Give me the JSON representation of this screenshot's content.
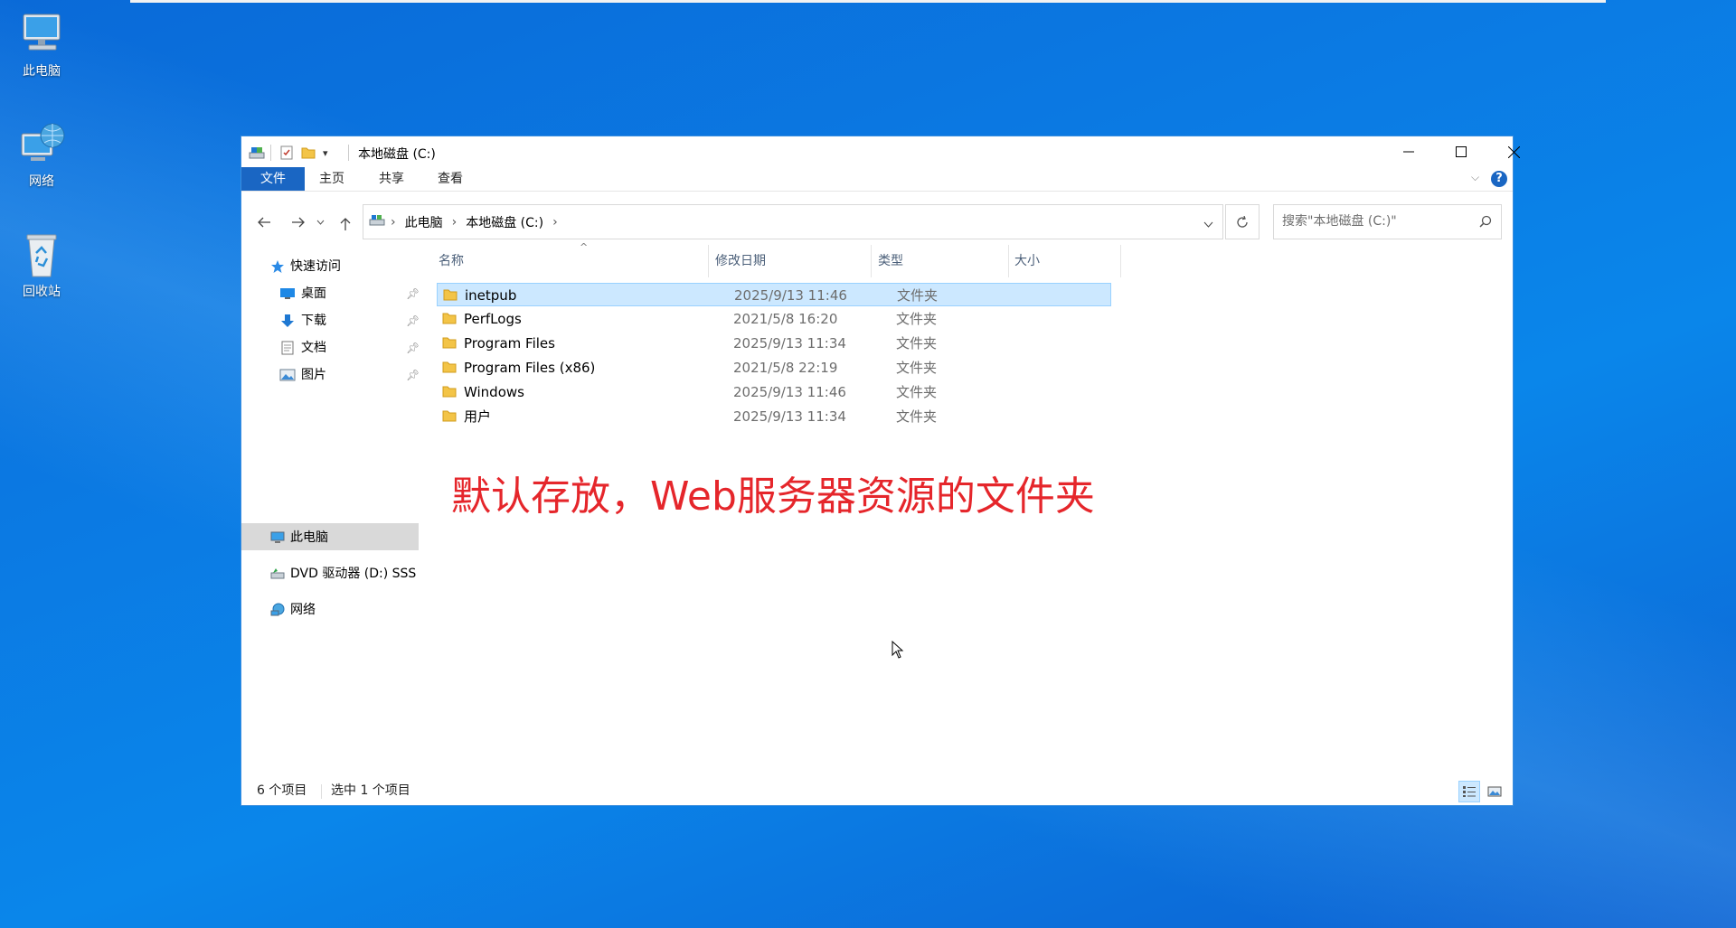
{
  "desktop": {
    "icons": [
      {
        "label": "此电脑",
        "icon": "computer-icon"
      },
      {
        "label": "网络",
        "icon": "network-icon"
      },
      {
        "label": "回收站",
        "icon": "recycle-bin-icon"
      }
    ]
  },
  "window": {
    "title": "本地磁盘 (C:)",
    "ribbon_tabs": [
      "文件",
      "主页",
      "共享",
      "查看"
    ],
    "help_label": "?",
    "breadcrumb": [
      "此电脑",
      "本地磁盘 (C:)"
    ],
    "search_placeholder": "搜索\"本地磁盘 (C:)\"",
    "nav_pane": {
      "quick_access": "快速访问",
      "quick_items": [
        "桌面",
        "下载",
        "文档",
        "图片"
      ],
      "this_pc": "此电脑",
      "dvd_drive": "DVD 驱动器 (D:) SSS",
      "network": "网络"
    },
    "columns": [
      "名称",
      "修改日期",
      "类型",
      "大小"
    ],
    "files": [
      {
        "name": "inetpub",
        "date": "2025/9/13 11:46",
        "type": "文件夹",
        "selected": true
      },
      {
        "name": "PerfLogs",
        "date": "2021/5/8 16:20",
        "type": "文件夹",
        "selected": false
      },
      {
        "name": "Program Files",
        "date": "2025/9/13 11:34",
        "type": "文件夹",
        "selected": false
      },
      {
        "name": "Program Files (x86)",
        "date": "2021/5/8 22:19",
        "type": "文件夹",
        "selected": false
      },
      {
        "name": "Windows",
        "date": "2025/9/13 11:46",
        "type": "文件夹",
        "selected": false
      },
      {
        "name": "用户",
        "date": "2025/9/13 11:34",
        "type": "文件夹",
        "selected": false
      }
    ],
    "annotation": "默认存放，Web服务器资源的文件夹",
    "status": {
      "item_count": "6 个项目",
      "selected_count": "选中 1 个项目"
    }
  },
  "colors": {
    "accent": "#1a66c3",
    "selection_bg": "#cce8ff",
    "annotation": "#e5262b",
    "desktop": "#0b7ae3"
  }
}
